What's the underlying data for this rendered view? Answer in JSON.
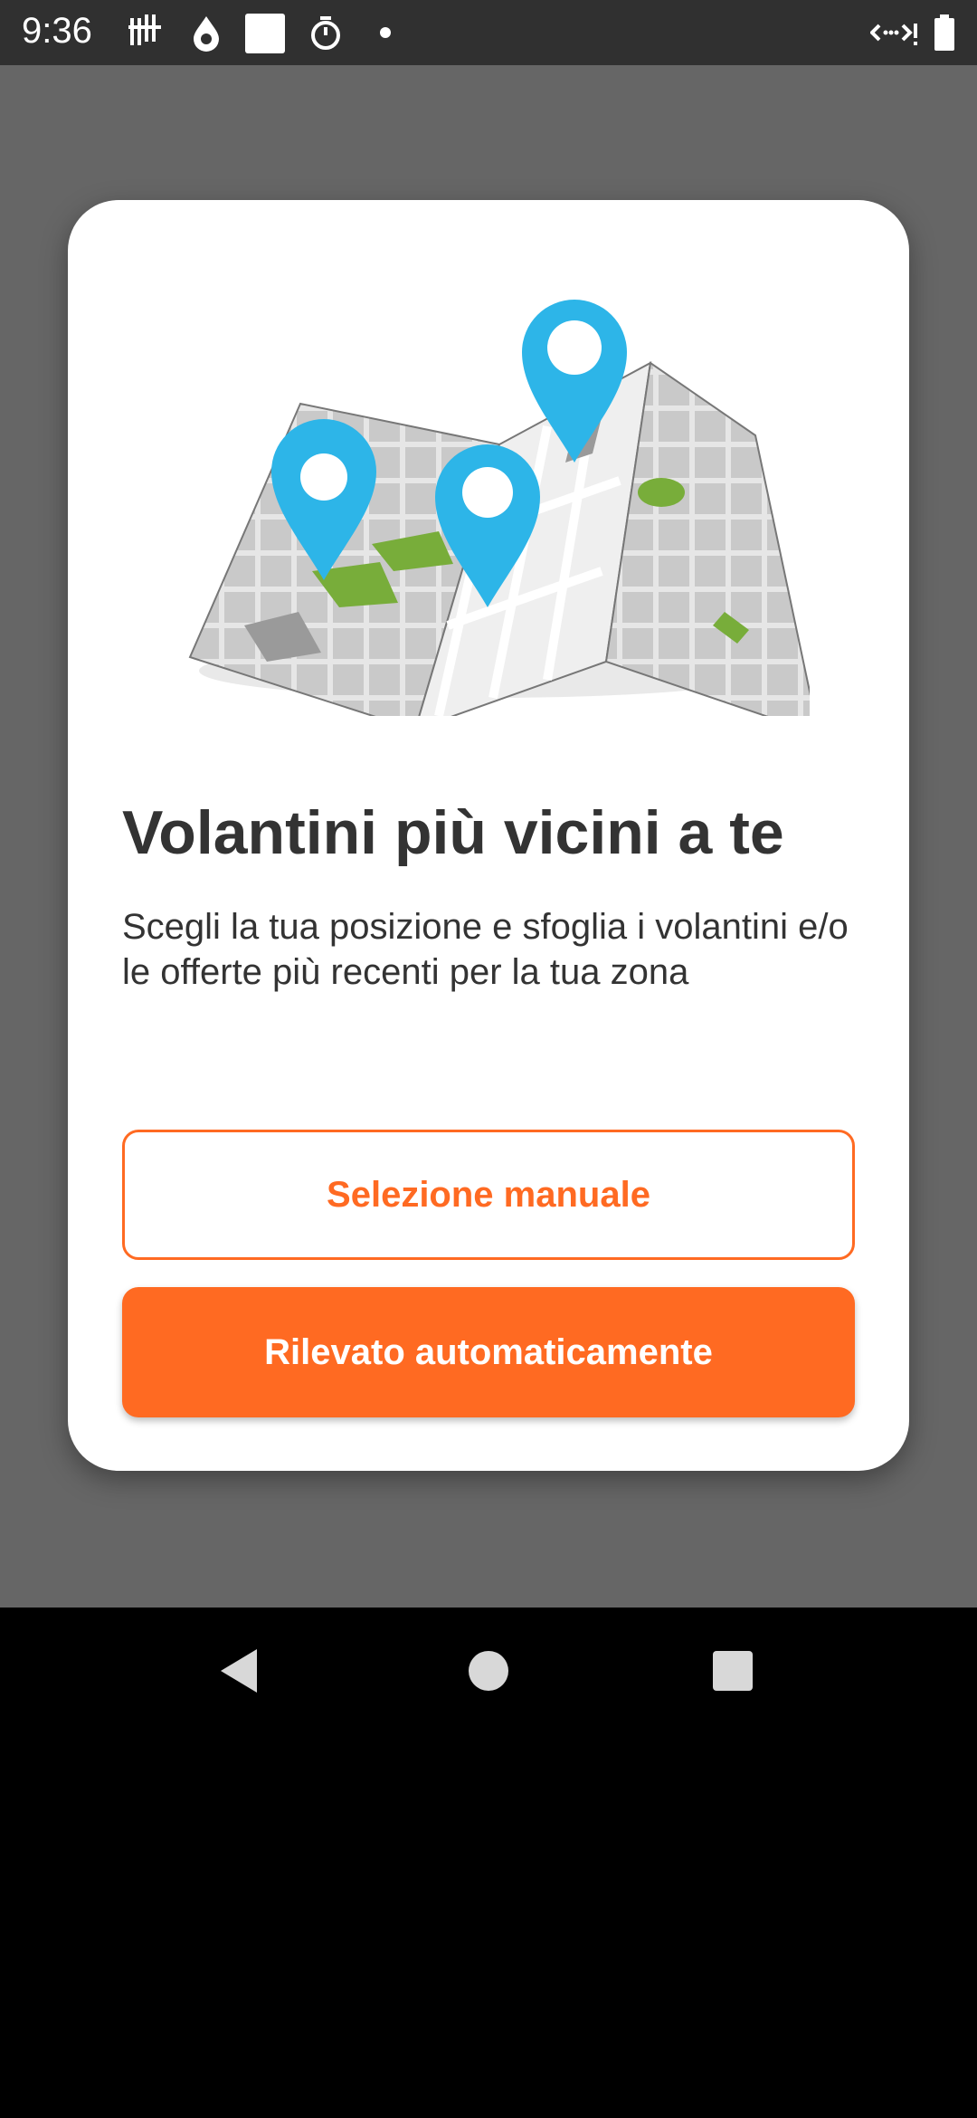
{
  "status_bar": {
    "time": "9:36",
    "icons": [
      "signal-bars-icon",
      "drop-icon",
      "square-icon",
      "timer-icon",
      "dot-icon",
      "data-arrows-icon",
      "battery-icon"
    ]
  },
  "dialog": {
    "title": "Volantini più vicini a te",
    "description": "Scegli la tua posizione e sfoglia i volantini e/o le offerte più recenti per la tua zona",
    "manual_button": "Selezione manuale",
    "auto_button": "Rilevato automaticamente"
  },
  "nav_bar": {
    "icons": [
      "back-icon",
      "home-icon",
      "recents-icon"
    ]
  },
  "colors": {
    "accent": "#ff6a22",
    "pin": "#2db5e8",
    "scrim": "#666666"
  }
}
